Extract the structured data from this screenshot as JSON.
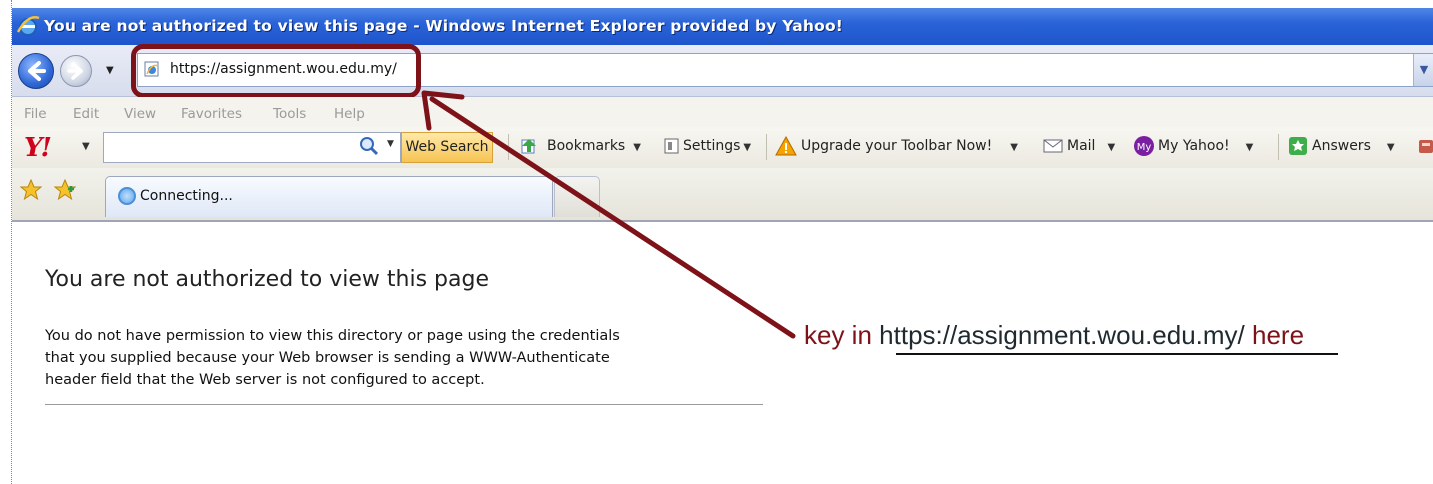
{
  "window": {
    "title": "You are not authorized to view this page - Windows Internet Explorer provided by Yahoo!"
  },
  "address_bar": {
    "url": "https://assignment.wou.edu.my/"
  },
  "menu": [
    "File",
    "Edit",
    "View",
    "Favorites",
    "Tools",
    "Help"
  ],
  "yahoo_toolbar": {
    "search_button": "Web Search",
    "items": [
      {
        "label": "Bookmarks",
        "icon": "bookmarks-icon"
      },
      {
        "label": "Settings",
        "icon": "settings-icon"
      },
      {
        "label": "Upgrade your Toolbar Now!",
        "icon": "warning-icon"
      },
      {
        "label": "Mail",
        "icon": "mail-icon"
      },
      {
        "label": "My Yahoo!",
        "icon": "my-yahoo-icon"
      },
      {
        "label": "Answers",
        "icon": "answers-icon"
      }
    ]
  },
  "tab": {
    "label": "Connecting..."
  },
  "page": {
    "title": "You are not authorized to view this page",
    "body_lines": [
      "You do not have permission to view this directory or page using the credentials",
      "that you supplied because your Web browser is sending a WWW-Authenticate",
      "header field that the Web server is not configured to accept."
    ]
  },
  "annotation": {
    "prefix": "key in",
    "url": "https://assignment.wou.edu.my/",
    "suffix": "here",
    "color": "#7d1218"
  }
}
